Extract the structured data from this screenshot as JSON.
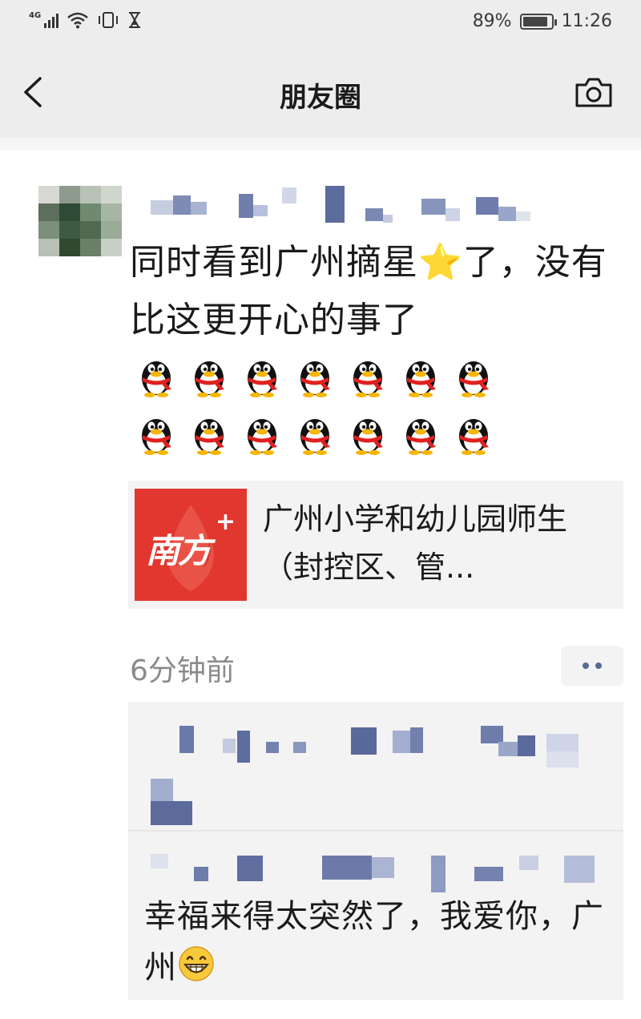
{
  "status_bar": {
    "network": "4G",
    "battery": "89%",
    "battery_level": 0.89,
    "time": "11:26"
  },
  "nav": {
    "title": "朋友圈",
    "back_icon": "back-arrow-icon",
    "camera_icon": "camera-icon"
  },
  "post": {
    "text": "同时看到广州摘星⭐了，没有比这更开心的事了",
    "emoji_icon": "qq-penguin-icon",
    "link": {
      "thumb_text": "南方",
      "thumb_plus": "+",
      "title": "广州小学和幼儿园师生（封控区、管..."
    },
    "time_ago": "6分钟前",
    "more_icon": "more-dots-icon"
  },
  "comment": {
    "text": "幸福来得太突然了，我爱你，广州",
    "emoji_icon": "grinning-face-icon"
  },
  "colors": {
    "header_bg": "#ededed",
    "link_blue": "#576b95",
    "card_bg": "#f3f3f3",
    "brand_red": "#e1372e"
  }
}
